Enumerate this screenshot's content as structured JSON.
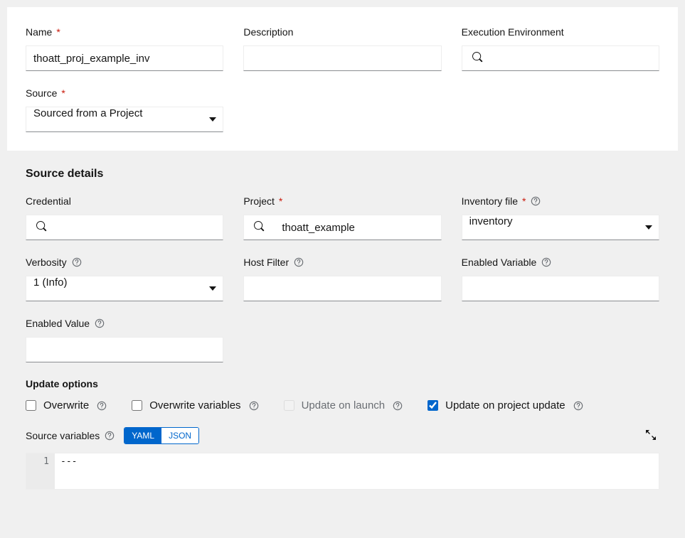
{
  "top": {
    "name_label": "Name",
    "name_value": "thoatt_proj_example_inv",
    "description_label": "Description",
    "description_value": "",
    "ee_label": "Execution Environment",
    "ee_value": "",
    "source_label": "Source",
    "source_value": "Sourced from a Project"
  },
  "details": {
    "section_title": "Source details",
    "credential_label": "Credential",
    "credential_value": "",
    "project_label": "Project",
    "project_value": "thoatt_example",
    "inv_file_label": "Inventory file",
    "inv_file_value": "inventory",
    "verbosity_label": "Verbosity",
    "verbosity_value": "1 (Info)",
    "host_filter_label": "Host Filter",
    "host_filter_value": "",
    "enabled_var_label": "Enabled Variable",
    "enabled_var_value": "",
    "enabled_value_label": "Enabled Value",
    "enabled_value_value": ""
  },
  "update_options": {
    "title": "Update options",
    "overwrite": "Overwrite",
    "overwrite_vars": "Overwrite variables",
    "update_on_launch": "Update on launch",
    "update_on_project": "Update on project update"
  },
  "source_vars": {
    "label": "Source variables",
    "yaml": "YAML",
    "json": "JSON",
    "gutter_1": "1",
    "content": "---"
  }
}
